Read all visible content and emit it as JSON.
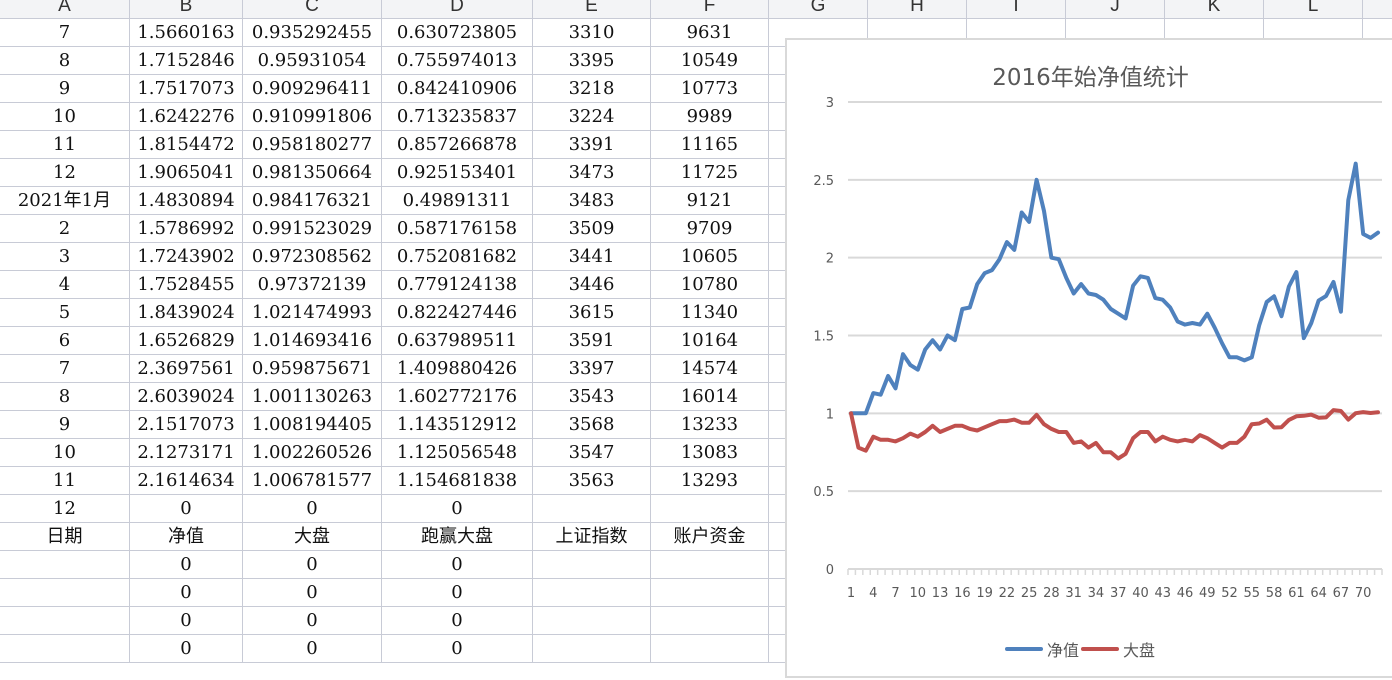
{
  "columns": [
    "A",
    "B",
    "C",
    "D",
    "E",
    "F",
    "G",
    "H",
    "I",
    "J",
    "K",
    "L"
  ],
  "rows": [
    [
      "7",
      "1.5660163",
      "0.935292455",
      "0.630723805",
      "3310",
      "9631"
    ],
    [
      "8",
      "1.7152846",
      "0.95931054",
      "0.755974013",
      "3395",
      "10549"
    ],
    [
      "9",
      "1.7517073",
      "0.909296411",
      "0.842410906",
      "3218",
      "10773"
    ],
    [
      "10",
      "1.6242276",
      "0.910991806",
      "0.713235837",
      "3224",
      "9989"
    ],
    [
      "11",
      "1.8154472",
      "0.958180277",
      "0.857266878",
      "3391",
      "11165"
    ],
    [
      "12",
      "1.9065041",
      "0.981350664",
      "0.925153401",
      "3473",
      "11725"
    ],
    [
      "2021年1月",
      "1.4830894",
      "0.984176321",
      "0.49891311",
      "3483",
      "9121"
    ],
    [
      "2",
      "1.5786992",
      "0.991523029",
      "0.587176158",
      "3509",
      "9709"
    ],
    [
      "3",
      "1.7243902",
      "0.972308562",
      "0.752081682",
      "3441",
      "10605"
    ],
    [
      "4",
      "1.7528455",
      "0.97372139",
      "0.779124138",
      "3446",
      "10780"
    ],
    [
      "5",
      "1.8439024",
      "1.021474993",
      "0.822427446",
      "3615",
      "11340"
    ],
    [
      "6",
      "1.6526829",
      "1.014693416",
      "0.637989511",
      "3591",
      "10164"
    ],
    [
      "7",
      "2.3697561",
      "0.959875671",
      "1.409880426",
      "3397",
      "14574"
    ],
    [
      "8",
      "2.6039024",
      "1.001130263",
      "1.602772176",
      "3543",
      "16014"
    ],
    [
      "9",
      "2.1517073",
      "1.008194405",
      "1.143512912",
      "3568",
      "13233"
    ],
    [
      "10",
      "2.1273171",
      "1.002260526",
      "1.125056548",
      "3547",
      "13083"
    ],
    [
      "11",
      "2.1614634",
      "1.006781577",
      "1.154681838",
      "3563",
      "13293"
    ],
    [
      "12",
      "0",
      "0",
      "0",
      "",
      ""
    ],
    [
      "日期",
      "净值",
      "大盘",
      "跑赢大盘",
      "上证指数",
      "账户资金"
    ],
    [
      "",
      "0",
      "0",
      "0",
      "",
      ""
    ],
    [
      "",
      "0",
      "0",
      "0",
      "",
      ""
    ],
    [
      "",
      "0",
      "0",
      "0",
      "",
      ""
    ],
    [
      "",
      "0",
      "0",
      "0",
      "",
      ""
    ]
  ],
  "chart_data": {
    "type": "line",
    "title": "2016年始净值统计",
    "xlabel": "",
    "ylabel": "",
    "ylim": [
      0,
      3
    ],
    "yticks": [
      "0",
      "0.5",
      "1",
      "1.5",
      "2",
      "2.5",
      "3"
    ],
    "grid": true,
    "legend_position": "bottom",
    "x_count": 72,
    "xtick_step": 3,
    "series": [
      {
        "name": "净值",
        "color": "#4f81bd",
        "values": [
          1.0,
          1.0,
          1.0,
          1.13,
          1.12,
          1.24,
          1.16,
          1.38,
          1.31,
          1.28,
          1.41,
          1.47,
          1.41,
          1.5,
          1.47,
          1.67,
          1.68,
          1.83,
          1.9,
          1.92,
          1.99,
          2.1,
          2.05,
          2.29,
          2.23,
          2.5,
          2.3,
          2.0,
          1.99,
          1.87,
          1.77,
          1.83,
          1.77,
          1.76,
          1.73,
          1.67,
          1.64,
          1.61,
          1.82,
          1.88,
          1.87,
          1.74,
          1.73,
          1.68,
          1.59,
          1.57,
          1.58,
          1.57,
          1.64,
          1.55,
          1.45,
          1.36,
          1.36,
          1.34,
          1.36,
          1.566,
          1.715,
          1.752,
          1.624,
          1.815,
          1.907,
          1.483,
          1.579,
          1.724,
          1.753,
          1.844,
          1.653,
          2.37,
          2.604,
          2.152,
          2.127,
          2.161
        ]
      },
      {
        "name": "大盘",
        "color": "#c0504d",
        "values": [
          1.0,
          0.78,
          0.76,
          0.85,
          0.83,
          0.83,
          0.82,
          0.84,
          0.87,
          0.85,
          0.88,
          0.92,
          0.88,
          0.9,
          0.92,
          0.92,
          0.9,
          0.89,
          0.91,
          0.93,
          0.95,
          0.95,
          0.96,
          0.94,
          0.94,
          0.99,
          0.93,
          0.9,
          0.88,
          0.88,
          0.81,
          0.82,
          0.78,
          0.81,
          0.75,
          0.75,
          0.71,
          0.74,
          0.84,
          0.88,
          0.88,
          0.82,
          0.85,
          0.83,
          0.82,
          0.83,
          0.82,
          0.86,
          0.84,
          0.81,
          0.78,
          0.81,
          0.81,
          0.85,
          0.93,
          0.935,
          0.959,
          0.909,
          0.911,
          0.958,
          0.981,
          0.984,
          0.992,
          0.972,
          0.974,
          1.021,
          1.015,
          0.96,
          1.001,
          1.008,
          1.002,
          1.007
        ]
      }
    ]
  }
}
